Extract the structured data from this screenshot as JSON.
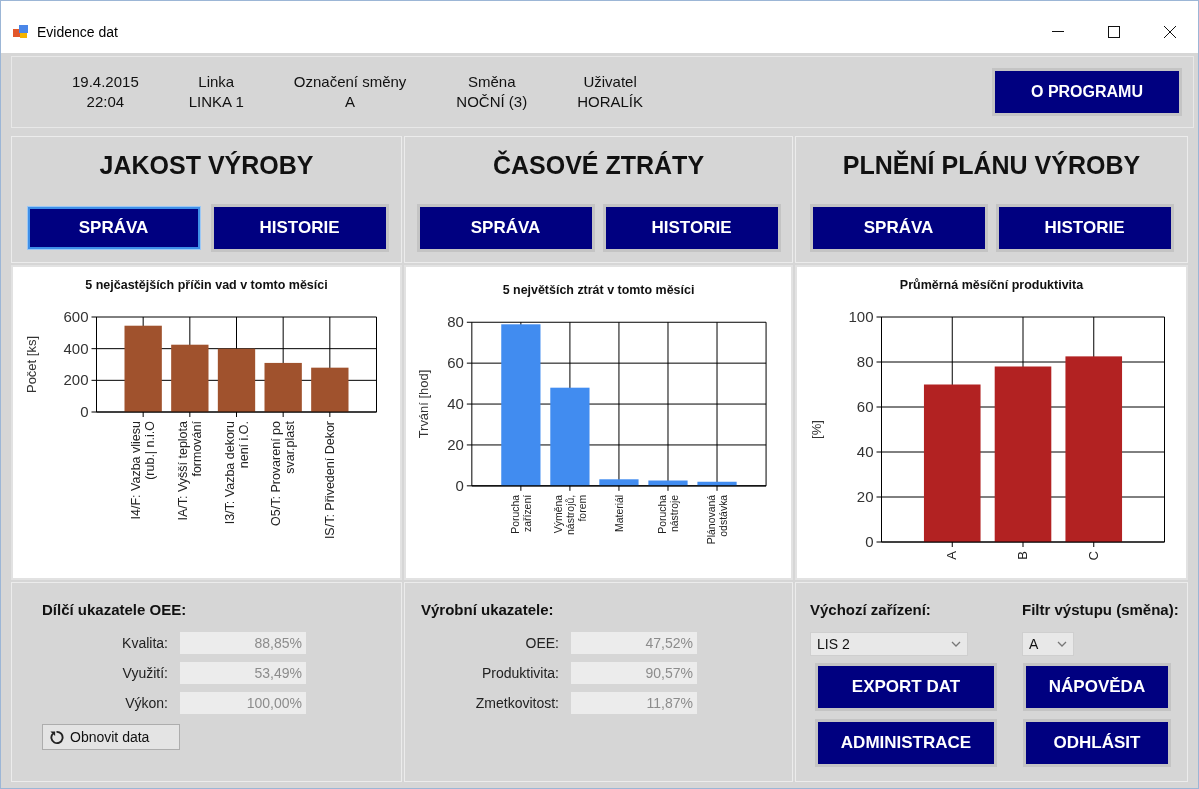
{
  "window": {
    "title": "Evidence dat"
  },
  "header": {
    "items": [
      {
        "label": "19.4.2015",
        "value": "22:04"
      },
      {
        "label": "Linka",
        "value": "LINKA 1"
      },
      {
        "label": "Označení směny",
        "value": "A"
      },
      {
        "label": "Směna",
        "value": "NOČNÍ (3)"
      },
      {
        "label": "Uživatel",
        "value": "HORALÍK"
      }
    ],
    "button": "O PROGRAMU"
  },
  "sections": [
    {
      "title": "JAKOST VÝROBY",
      "buttons": [
        {
          "label": "SPRÁVA",
          "focused": true
        },
        {
          "label": "HISTORIE",
          "focused": false
        }
      ],
      "chart_data": {
        "type": "bar",
        "title": "5 nejčastějších příčin vad v tomto měsíci",
        "ylabel": "Počet [ks]",
        "categories": [
          "I4/F: Vazba vliesu (rub.| n.i.O",
          "IA/T: Vyšší teplota formování",
          "I3/T: Vazba dekoru není i.O.",
          "O5/T: Provarení po svar.plast",
          "IS/T: Přivedení Dekor"
        ],
        "series": [
          {
            "color": "#a0522d",
            "values": [
              545,
              425,
              400,
              310,
              280
            ]
          }
        ],
        "grid": true,
        "ylim": [
          0,
          600
        ],
        "yticks": [
          0,
          200,
          400,
          600
        ]
      }
    },
    {
      "title": "ČASOVÉ ZTRÁTY",
      "buttons": [
        {
          "label": "SPRÁVA",
          "focused": false
        },
        {
          "label": "HISTORIE",
          "focused": false
        }
      ],
      "chart_data": {
        "type": "bar",
        "title": "5 největších ztrát v tomto měsíci",
        "ylabel": "Trvání [hod]",
        "categories": [
          "Porucha zařízení",
          "Výměna nástrojů, forem",
          "Materiál",
          "Porucha nástroje",
          "Plánovaná odstávka"
        ],
        "series": [
          {
            "color": "#418cf0",
            "values": [
              79,
              48,
              3.2,
              2.6,
              2
            ]
          }
        ],
        "grid": true,
        "ylim": [
          0,
          80
        ],
        "yticks": [
          0,
          20,
          40,
          60,
          80
        ]
      }
    },
    {
      "title": "PLNĚNÍ PLÁNU VÝROBY",
      "buttons": [
        {
          "label": "SPRÁVA",
          "focused": false
        },
        {
          "label": "HISTORIE",
          "focused": false
        }
      ],
      "chart_data": {
        "type": "bar",
        "title": "Průměrná měsíční produktivita",
        "ylabel": "[%]",
        "categories": [
          "A",
          "B",
          "C"
        ],
        "series": [
          {
            "color": "#b22222",
            "values": [
              70,
              78,
              82.5
            ]
          }
        ],
        "grid": true,
        "ylim": [
          0,
          100
        ],
        "yticks": [
          0,
          20,
          40,
          60,
          80,
          100
        ]
      }
    }
  ],
  "oee": {
    "title": "Dílčí ukazatele OEE:",
    "fields": [
      {
        "label": "Kvalita:",
        "value": "88,85%",
        "disabled": true
      },
      {
        "label": "Využití:",
        "value": "53,49%",
        "disabled": true
      },
      {
        "label": "Výkon:",
        "value": "100,00%",
        "disabled": true
      }
    ],
    "refresh_button": "Obnovit data"
  },
  "production": {
    "title": "Výrobní ukazatele:",
    "fields": [
      {
        "label": "OEE:",
        "value": "47,52%",
        "disabled": true
      },
      {
        "label": "Produktivita:",
        "value": "90,57%",
        "disabled": true
      },
      {
        "label": "Zmetkovitost:",
        "value": "11,87%",
        "disabled": true
      }
    ]
  },
  "settings": {
    "device_label": "Výchozí zařízení:",
    "device": "LIS 2",
    "filter_label": "Filtr výstupu (směna):",
    "filter": "A",
    "buttons": [
      "EXPORT DAT",
      "NÁPOVĚDA",
      "ADMINISTRACE",
      "ODHLÁSIT"
    ]
  }
}
